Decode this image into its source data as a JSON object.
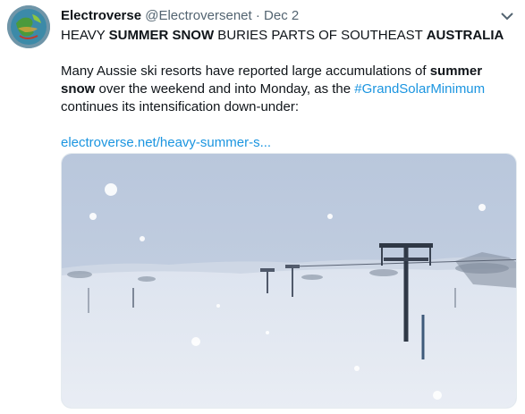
{
  "tweet": {
    "display_name": "Electroverse",
    "handle": "@Electroversenet",
    "separator": "·",
    "date": "Dec 2",
    "headline": {
      "p1": "HEAVY ",
      "p2": "SUMMER SNOW",
      "p3": " BURIES PARTS OF SOUTHEAST ",
      "p4": "AUSTRALIA"
    },
    "body": {
      "p1": "Many Aussie ski resorts have reported large accumulations of ",
      "p2": "summer snow",
      "p3": " over the weekend and into Monday, as the ",
      "hashtag": "#GrandSolarMinimum",
      "p4": " continues its intensification down-under:"
    },
    "link": "electroverse.net/heavy-summer-s..."
  },
  "icons": {
    "avatar": "earth-globe-avatar",
    "more": "chevron-down-icon"
  },
  "colors": {
    "link": "#1b95e0",
    "text": "#0f1419",
    "muted": "#536471"
  }
}
